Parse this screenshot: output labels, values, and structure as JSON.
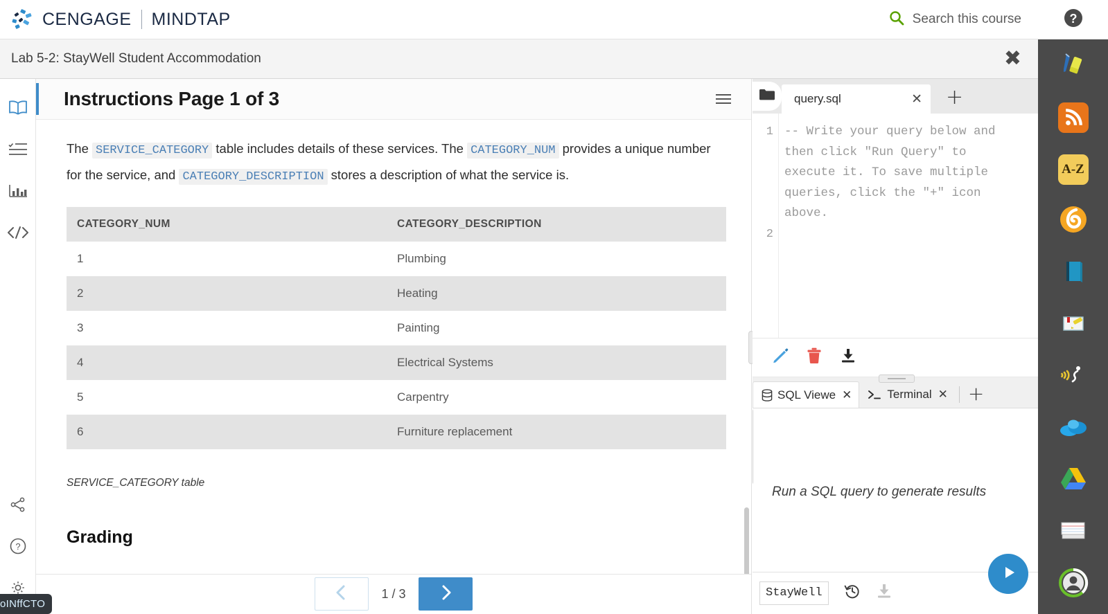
{
  "brand": {
    "logo_icon": "cengage-spark-icon",
    "name": "CENGAGE",
    "product": "MINDTAP",
    "search_icon": "search-icon",
    "search_label": "Search this course",
    "help_icon": "help-circle-icon",
    "accent_green": "#59a100",
    "brand_navy": "#1b2a44"
  },
  "titlebar": {
    "title": "Lab 5-2: StayWell Student Accommodation",
    "close_icon": "close-icon",
    "close_glyph": "✖"
  },
  "rail": {
    "items": [
      {
        "name": "sidebar-item-book",
        "icon": "book-icon",
        "active": true
      },
      {
        "name": "sidebar-item-checklist",
        "icon": "checklist-icon",
        "active": false
      },
      {
        "name": "sidebar-item-progress",
        "icon": "bar-chart-icon",
        "active": false
      },
      {
        "name": "sidebar-item-code",
        "icon": "code-icon",
        "active": false
      }
    ],
    "bottom_items": [
      {
        "name": "sidebar-item-share",
        "icon": "share-icon"
      },
      {
        "name": "sidebar-item-help",
        "icon": "question-circle-icon"
      },
      {
        "name": "sidebar-item-settings",
        "icon": "gear-icon"
      }
    ],
    "active_color": "#3f8cc9",
    "inactive_color": "#6b6b6b"
  },
  "instructions": {
    "heading": "Instructions Page 1 of 3",
    "menu_icon": "hamburger-menu-icon",
    "paragraph": {
      "p1": "The ",
      "code1": "SERVICE_CATEGORY",
      "p2": " table includes details of these services. The ",
      "code2": "CATEGORY_NUM",
      "p3": " provides a unique number for the service, and ",
      "code3": "CATEGORY_DESCRIPTION",
      "p4": " stores a description of what the service is."
    },
    "table": {
      "headers": [
        "CATEGORY_NUM",
        "CATEGORY_DESCRIPTION"
      ],
      "rows": [
        [
          "1",
          "Plumbing"
        ],
        [
          "2",
          "Heating"
        ],
        [
          "3",
          "Painting"
        ],
        [
          "4",
          "Electrical Systems"
        ],
        [
          "5",
          "Carpentry"
        ],
        [
          "6",
          "Furniture replacement"
        ]
      ]
    },
    "caption": "SERVICE_CATEGORY table",
    "grading_heading": "Grading",
    "pager": {
      "prev_icon": "chevron-left-icon",
      "next_icon": "chevron-right-icon",
      "count": "1 / 3",
      "prev_enabled": false,
      "next_color": "#3f8cc9"
    }
  },
  "ide": {
    "folder_icon": "folder-icon",
    "file_tab": {
      "name": "query.sql",
      "close_icon": "close-icon",
      "close_glyph": "✕"
    },
    "new_tab_icon": "plus-icon",
    "new_tab_glyph": "+",
    "editor": {
      "line_numbers": [
        "1",
        "2"
      ],
      "code": "-- Write your query below and\nthen click \"Run Query\" to\nexecute it. To save multiple\nqueries, click the \"+\" icon\nabove."
    },
    "editor_toolbar": [
      {
        "name": "edit-pencil-button",
        "icon": "pencil-icon",
        "color": "#4aa3df"
      },
      {
        "name": "delete-button",
        "icon": "trash-icon",
        "color": "#e8564d"
      },
      {
        "name": "download-button",
        "icon": "download-icon",
        "color": "#262626"
      }
    ],
    "result_tabs": [
      {
        "name": "tab-sql-viewer",
        "label": "SQL Viewe",
        "icon": "database-icon",
        "close_glyph": "✕",
        "active": true
      },
      {
        "name": "tab-terminal",
        "label": "Terminal",
        "icon": "terminal-icon",
        "close_glyph": "✕",
        "active": false
      }
    ],
    "result_new_tab_glyph": "+",
    "result_empty_text": "Run a SQL query to generate results",
    "footer": {
      "database": "StayWell",
      "history_icon": "history-icon",
      "download_icon": "download-icon",
      "run_icon": "play-icon",
      "run_color": "#2e8ccb"
    }
  },
  "darkbar": {
    "items": [
      {
        "name": "tool-highlighter",
        "icon": "pen-highlighter-icon"
      },
      {
        "name": "tool-rss",
        "icon": "rss-icon",
        "color": "#e8751a"
      },
      {
        "name": "tool-dictionary",
        "icon": "a-z-icon",
        "color": "#f2cc5b",
        "label": "A-Z"
      },
      {
        "name": "tool-bitly",
        "icon": "spiral-six-icon",
        "color": "#f5a623"
      },
      {
        "name": "tool-ebook",
        "icon": "blue-book-icon",
        "color": "#2196c4"
      },
      {
        "name": "tool-annotate",
        "icon": "note-highlight-icon"
      },
      {
        "name": "tool-read-aloud",
        "icon": "speech-icon"
      },
      {
        "name": "tool-onedrive",
        "icon": "cloud-icon",
        "color": "#28a8ea"
      },
      {
        "name": "tool-google-drive",
        "icon": "google-drive-icon"
      },
      {
        "name": "tool-flashcards",
        "icon": "index-cards-icon"
      },
      {
        "name": "tool-profile",
        "icon": "avatar-icon",
        "color": "#6abf2a"
      }
    ]
  },
  "corner_tooltip": {
    "text": "oINffCTO"
  }
}
